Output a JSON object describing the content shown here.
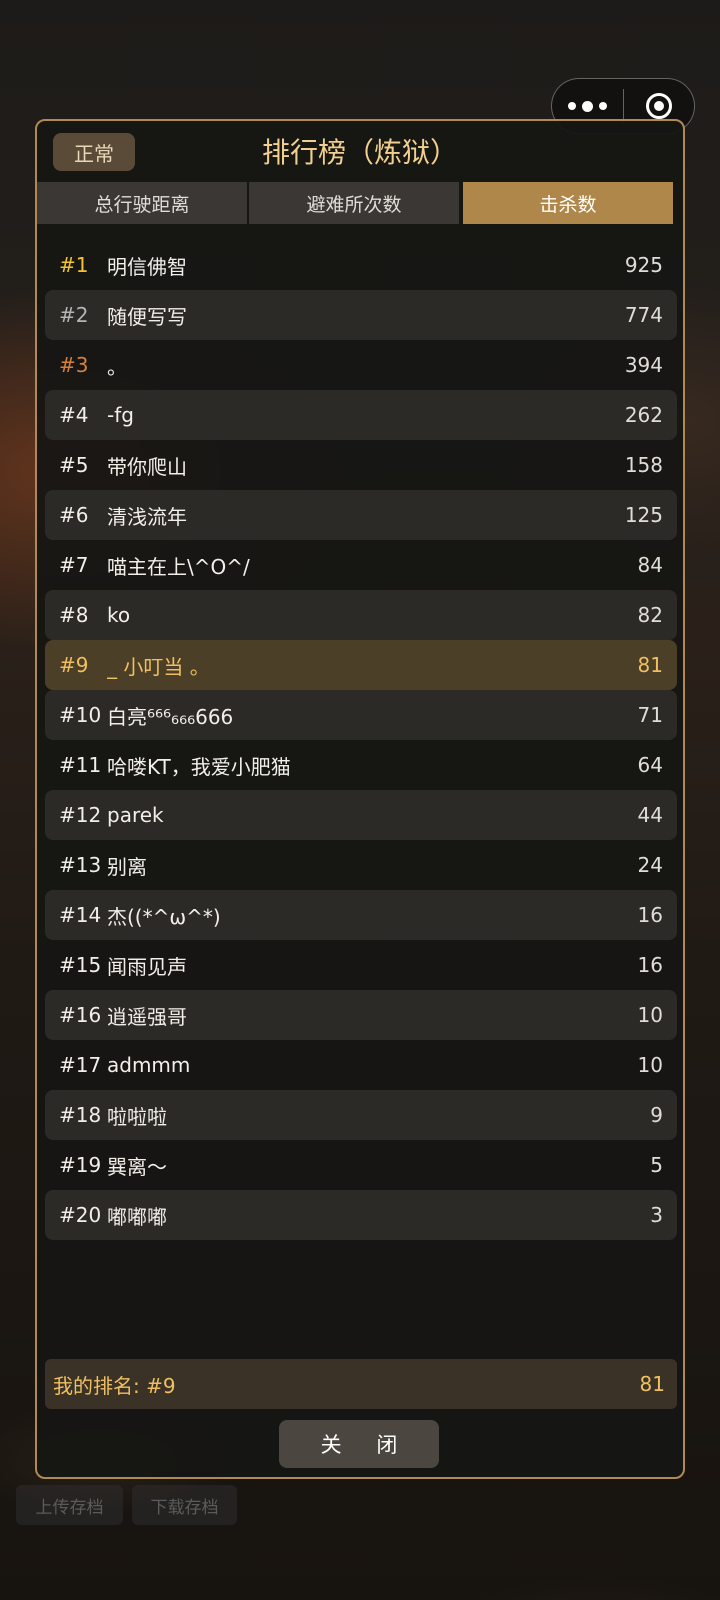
{
  "panel": {
    "title": "排行榜（炼狱）",
    "mode_label": "正常",
    "tabs": [
      {
        "label": "总行驶距离",
        "active": false
      },
      {
        "label": "避难所次数",
        "active": false
      },
      {
        "label": "击杀数",
        "active": true
      }
    ],
    "rows": [
      {
        "rank": "#1",
        "name": "明信佛智",
        "score": "925"
      },
      {
        "rank": "#2",
        "name": "随便写写",
        "score": "774"
      },
      {
        "rank": "#3",
        "name": "。",
        "score": "394"
      },
      {
        "rank": "#4",
        "name": "-fg",
        "score": "262"
      },
      {
        "rank": "#5",
        "name": "带你爬山",
        "score": "158"
      },
      {
        "rank": "#6",
        "name": "清浅流年",
        "score": "125"
      },
      {
        "rank": "#7",
        "name": "喵主在上\\^O^/",
        "score": "84"
      },
      {
        "rank": "#8",
        "name": "ko",
        "score": "82"
      },
      {
        "rank": "#9",
        "name": "_ 小叮当 。",
        "score": "81"
      },
      {
        "rank": "#10",
        "name": "白亮⁶⁶⁶₆₆₆666",
        "score": "71"
      },
      {
        "rank": "#11",
        "name": "哈喽KT，我爱小肥猫",
        "score": "64"
      },
      {
        "rank": "#12",
        "name": "parek",
        "score": "44"
      },
      {
        "rank": "#13",
        "name": "别离",
        "score": "24"
      },
      {
        "rank": "#14",
        "name": "杰((*^ω^*)",
        "score": "16"
      },
      {
        "rank": "#15",
        "name": "闻雨见声",
        "score": "16"
      },
      {
        "rank": "#16",
        "name": "逍遥强哥",
        "score": "10"
      },
      {
        "rank": "#17",
        "name": "admmm",
        "score": "10"
      },
      {
        "rank": "#18",
        "name": "啦啦啦",
        "score": "9"
      },
      {
        "rank": "#19",
        "name": "巽离～",
        "score": "5"
      },
      {
        "rank": "#20",
        "name": "嘟嘟嘟",
        "score": "3"
      }
    ],
    "my_rank": {
      "label": "我的排名: #9",
      "score": "81"
    },
    "close_label": "关 闭"
  },
  "bottom_buttons": [
    "上传存档",
    "下载存档"
  ],
  "colors": {
    "accent": "#b0874a",
    "title": "#f1cf8e",
    "gold": "#f4c430",
    "silver": "#b5b5b5",
    "bronze": "#d5813a",
    "highlight_row": "#4c3f27"
  }
}
